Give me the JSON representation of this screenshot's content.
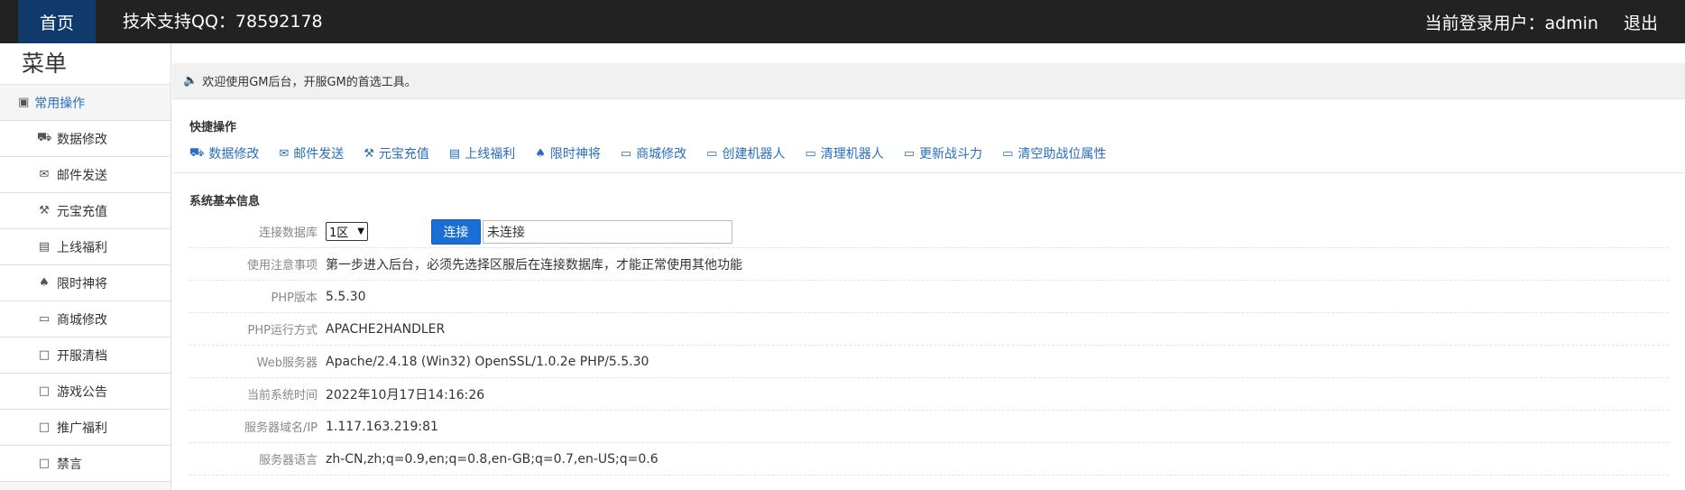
{
  "topbar": {
    "home": "首页",
    "support": "技术支持QQ：78592178",
    "user_label": "当前登录用户：admin",
    "logout": "退出"
  },
  "sidebar": {
    "title": "菜单",
    "group": {
      "label": "常用操作",
      "icon": "book-icon"
    },
    "items": [
      {
        "label": "数据修改",
        "icon": "truck-icon"
      },
      {
        "label": "邮件发送",
        "icon": "envelope-icon"
      },
      {
        "label": "元宝充值",
        "icon": "wrench-icon"
      },
      {
        "label": "上线福利",
        "icon": "list-icon"
      },
      {
        "label": "限时神将",
        "icon": "spade-icon"
      },
      {
        "label": "商城修改",
        "icon": "folder-icon"
      },
      {
        "label": "开服清档",
        "icon": "file-icon"
      },
      {
        "label": "游戏公告",
        "icon": "file-icon"
      },
      {
        "label": "推广福利",
        "icon": "file-icon"
      },
      {
        "label": "禁言",
        "icon": "file-icon"
      }
    ]
  },
  "welcome": "欢迎使用GM后台，开服GM的首选工具。",
  "quick": {
    "title": "快捷操作",
    "links": [
      {
        "label": "数据修改",
        "icon": "truck-icon"
      },
      {
        "label": "邮件发送",
        "icon": "envelope-icon"
      },
      {
        "label": "元宝充值",
        "icon": "wrench-icon"
      },
      {
        "label": "上线福利",
        "icon": "list-icon"
      },
      {
        "label": "限时神将",
        "icon": "spade-icon"
      },
      {
        "label": "商城修改",
        "icon": "folder-icon"
      },
      {
        "label": "创建机器人",
        "icon": "folder-icon"
      },
      {
        "label": "清理机器人",
        "icon": "folder-icon"
      },
      {
        "label": "更新战斗力",
        "icon": "folder-icon"
      },
      {
        "label": "清空助战位属性",
        "icon": "folder-icon"
      }
    ]
  },
  "system": {
    "title": "系统基本信息",
    "db_label": "连接数据库",
    "db_zone": "1区",
    "connect_button": "连接",
    "connect_status": "未连接",
    "rows": [
      {
        "label": "使用注意事项",
        "value": "第一步进入后台，必须先选择区服后在连接数据库，才能正常使用其他功能"
      },
      {
        "label": "PHP版本",
        "value": "5.5.30"
      },
      {
        "label": "PHP运行方式",
        "value": "APACHE2HANDLER"
      },
      {
        "label": "Web服务器",
        "value": "Apache/2.4.18 (Win32) OpenSSL/1.0.2e PHP/5.5.30"
      },
      {
        "label": "当前系统时间",
        "value": "2022年10月17日14:16:26"
      },
      {
        "label": "服务器域名/IP",
        "value": "1.117.163.219:81"
      },
      {
        "label": "服务器语言",
        "value": "zh-CN,zh;q=0.9,en;q=0.8,en-GB;q=0.7,en-US;q=0.6"
      }
    ]
  }
}
